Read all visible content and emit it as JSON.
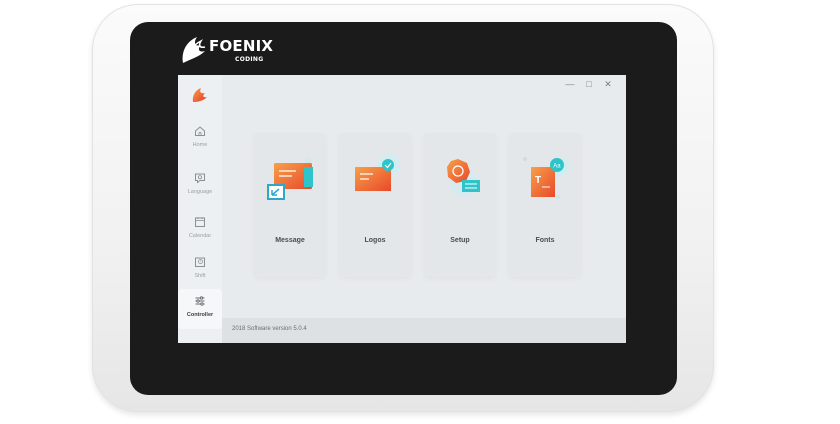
{
  "brand": {
    "name": "FOENIX",
    "tagline": "CODING"
  },
  "window": {
    "controls": [
      "—",
      "□",
      "✕"
    ]
  },
  "sidebar": {
    "logo_icon": "phoenix-flame-icon",
    "items": [
      {
        "label": "Home",
        "icon": "home-icon"
      },
      {
        "label": "Language",
        "icon": "language-icon"
      },
      {
        "label": "Calendar",
        "icon": "calendar-icon"
      },
      {
        "label": "Shift",
        "icon": "shift-icon"
      },
      {
        "label": "Controller",
        "icon": "sliders-icon",
        "active": true
      }
    ]
  },
  "cards": [
    {
      "label": "Message",
      "icon": "message-illustration"
    },
    {
      "label": "Logos",
      "icon": "logos-illustration"
    },
    {
      "label": "Setup",
      "icon": "setup-gear-illustration"
    },
    {
      "label": "Fonts",
      "icon": "fonts-illustration"
    }
  ],
  "footer": {
    "text": "2018 Software version 5.0.4"
  },
  "colors": {
    "accent_orange": "#f26a3a",
    "accent_red": "#e8492b",
    "accent_teal": "#2ec4c9",
    "screen_bg": "#e8ebee",
    "bezel": "#1b1b1b"
  }
}
